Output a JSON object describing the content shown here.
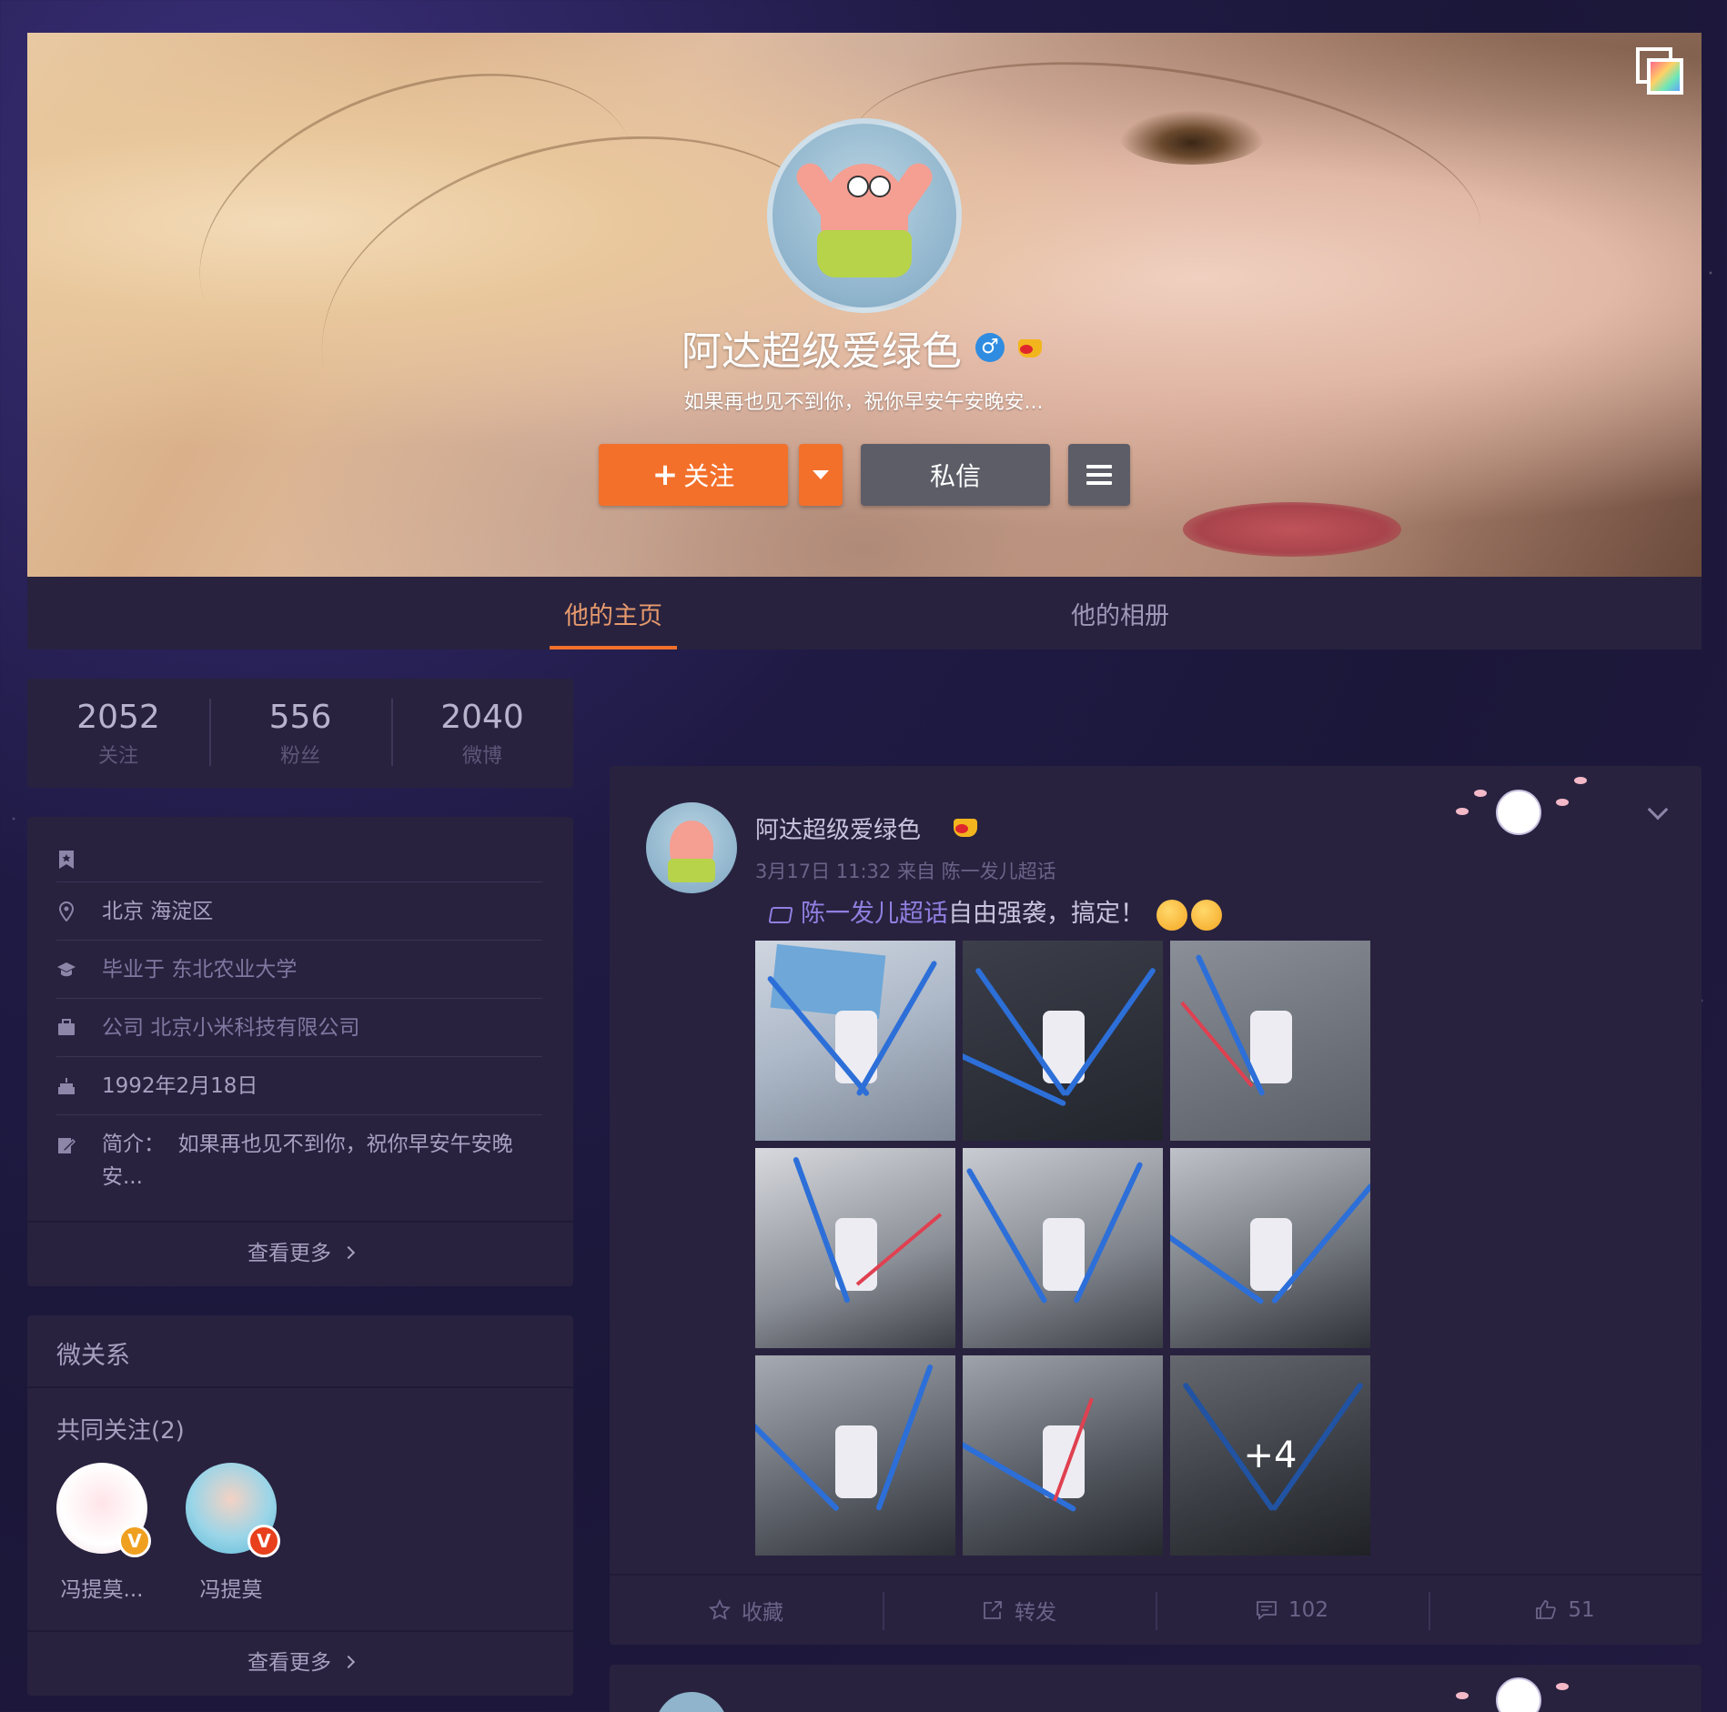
{
  "profile": {
    "name": "阿达超级爱绿色",
    "description": "如果再也见不到你，祝你早安午安晚安...",
    "follow_label": "关注",
    "message_label": "私信"
  },
  "tabs": [
    {
      "label": "他的主页",
      "active": true
    },
    {
      "label": "他的相册",
      "active": false
    }
  ],
  "stats": [
    {
      "value": "2052",
      "label": "关注"
    },
    {
      "value": "556",
      "label": "粉丝"
    },
    {
      "value": "2040",
      "label": "微博"
    }
  ],
  "info": {
    "location": "北京 海淀区",
    "education_prefix": "毕业于",
    "education": "东北农业大学",
    "company_prefix": "公司",
    "company": "北京小米科技有限公司",
    "birthday": "1992年2月18日",
    "bio_prefix": "简介：",
    "bio": "如果再也见不到你，祝你早安午安晚安...",
    "more_label": "查看更多"
  },
  "relations": {
    "title": "微关系",
    "mutual_title": "共同关注(2)",
    "friends": [
      {
        "name": "冯提莫...",
        "badge": "V",
        "badge_color": "#f0a020"
      },
      {
        "name": "冯提莫",
        "badge": "V",
        "badge_color": "#e8401c"
      }
    ],
    "more_label": "查看更多"
  },
  "post": {
    "author": "阿达超级爱绿色",
    "time": "3月17日 11:32",
    "source_prefix": "来自",
    "source": "陈一发儿超话",
    "topic": "陈一发儿超话",
    "text": "自由强袭，搞定！",
    "more_photos": "+4",
    "actions": {
      "favorite": "收藏",
      "repost": "转发",
      "comments": "102",
      "likes": "51"
    }
  },
  "colors": {
    "accent": "#f3702b",
    "card_bg": "#28223f",
    "page_bg": "#1f1a44",
    "topic": "#8f80e0"
  },
  "icons": [
    "cover-switch-icon",
    "gender-male-icon",
    "vip-crown-icon",
    "caret-down-icon",
    "menu-icon",
    "bookmark-icon",
    "location-icon",
    "education-icon",
    "briefcase-icon",
    "birthday-cake-icon",
    "edit-icon",
    "chevron-right-icon",
    "verified-v-icon",
    "chevron-down-icon",
    "super-topic-icon",
    "star-icon",
    "share-icon",
    "comment-icon",
    "thumbs-up-icon"
  ]
}
